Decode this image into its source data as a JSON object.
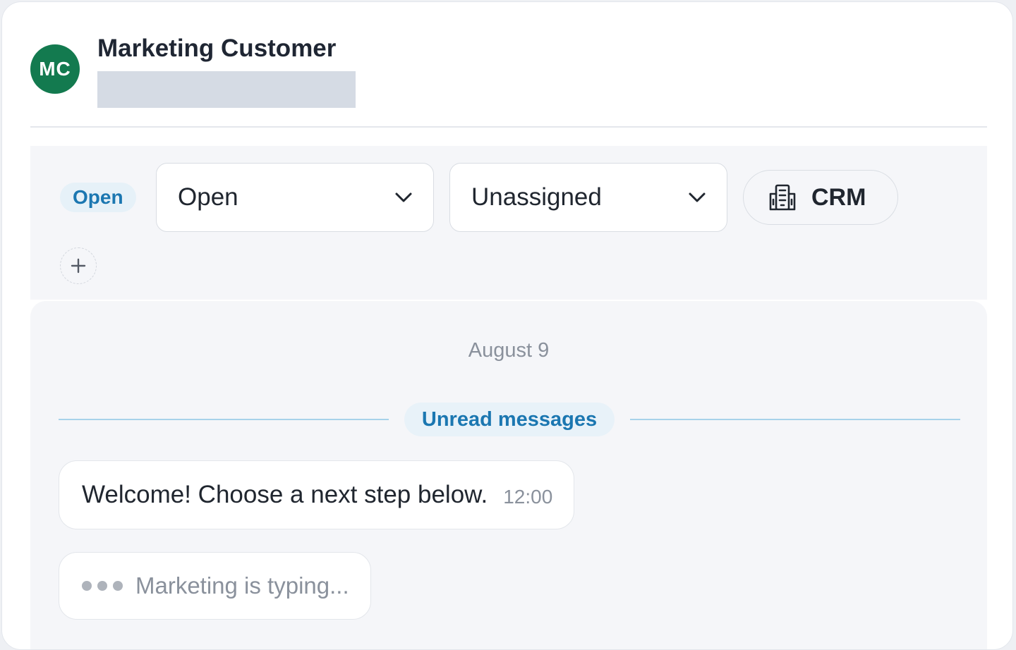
{
  "conversation": {
    "avatar_initials": "MC",
    "avatar_color": "#137a4f",
    "customer_name": "Marketing Customer"
  },
  "toolbar": {
    "status_badge": "Open",
    "status_dropdown_value": "Open",
    "assignee_dropdown_value": "Unassigned",
    "crm_button_label": "CRM",
    "crm_icon": "building-icon",
    "add_icon": "plus-icon",
    "dropdown_icon": "chevron-down-icon"
  },
  "chat": {
    "date_label": "August 9",
    "unread_label": "Unread messages",
    "messages": [
      {
        "text": "Welcome! Choose a next step below.",
        "time": "12:00"
      }
    ],
    "typing_indicator": "Marketing is typing..."
  },
  "colors": {
    "accent_blue": "#1b77b1",
    "badge_bg": "#e6f1f8",
    "panel_bg": "#f5f6f9"
  }
}
